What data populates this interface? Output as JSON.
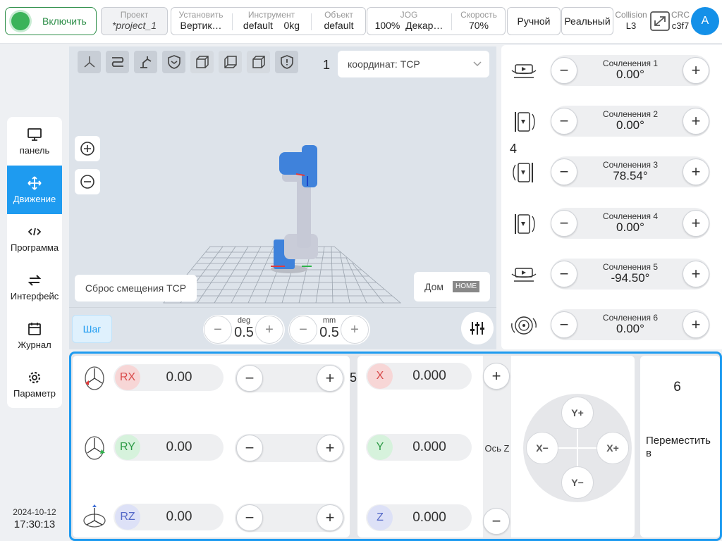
{
  "topbar": {
    "enable_label": "Включить",
    "project_caption": "Проект",
    "project_value": "*project_1",
    "install_caption": "Установить",
    "install_value": "Вертик…",
    "tool_caption": "Инструмент",
    "tool_value": "default",
    "tool_weight": "0kg",
    "object_caption": "Объект",
    "object_value": "default",
    "jog_caption": "JOG",
    "jog_percent": "100%",
    "jog_value": "Декар…",
    "speed_caption": "Скорость",
    "speed_value": "70%",
    "mode_manual": "Ручной",
    "mode_real": "Реальный",
    "collision_caption": "Collision",
    "collision_value": "L3",
    "crc_caption": "CRC",
    "crc_value": "c3f7",
    "avatar_letter": "A"
  },
  "sidebar": {
    "items": [
      {
        "label": "панель",
        "icon": "monitor-icon"
      },
      {
        "label": "Движение",
        "icon": "move-icon"
      },
      {
        "label": "Программа",
        "icon": "code-icon"
      },
      {
        "label": "Интерфейс",
        "icon": "swap-icon"
      },
      {
        "label": "Журнал",
        "icon": "calendar-icon"
      },
      {
        "label": "Параметр",
        "icon": "gear-icon"
      }
    ],
    "active_index": 1
  },
  "clock": {
    "date": "2024-10-12",
    "time": "17:30:13"
  },
  "view": {
    "label_1": "1",
    "coord_select": "координат: TCP",
    "reset_label": "Сброс смещения TCP",
    "home_label": "Дом",
    "home_badge": "HOME",
    "step_label": "Шаг",
    "deg_unit": "deg",
    "deg_value": "0.5",
    "mm_unit": "mm",
    "mm_value": "0.5"
  },
  "joints": {
    "label_4": "4",
    "items": [
      {
        "name": "Сочленения 1",
        "value": "0.00°"
      },
      {
        "name": "Сочленения 2",
        "value": "0.00°"
      },
      {
        "name": "Сочленения 3",
        "value": "78.54°"
      },
      {
        "name": "Сочленения 4",
        "value": "0.00°"
      },
      {
        "name": "Сочленения 5",
        "value": "-94.50°"
      },
      {
        "name": "Сочленения 6",
        "value": "0.00°"
      }
    ]
  },
  "rotation": {
    "label_5": "5",
    "rx": {
      "axis": "RX",
      "value": "0.00"
    },
    "ry": {
      "axis": "RY",
      "value": "0.00"
    },
    "rz": {
      "axis": "RZ",
      "value": "0.00"
    }
  },
  "position": {
    "x": {
      "axis": "X",
      "value": "0.000"
    },
    "y": {
      "axis": "Y",
      "value": "0.000"
    },
    "z": {
      "axis": "Z",
      "value": "0.000"
    },
    "z_axis_label": "Ось Z",
    "dpad": {
      "up": "Y+",
      "down": "Y−",
      "left": "X−",
      "right": "X+"
    }
  },
  "move": {
    "label_6": "6",
    "label": "Переместить в"
  },
  "colors": {
    "accent": "#1e9bf0",
    "enable_green": "#3bb35a",
    "x_red": "#f7d6d6",
    "y_green": "#d6f2dc",
    "z_blue": "#dde1f7"
  }
}
